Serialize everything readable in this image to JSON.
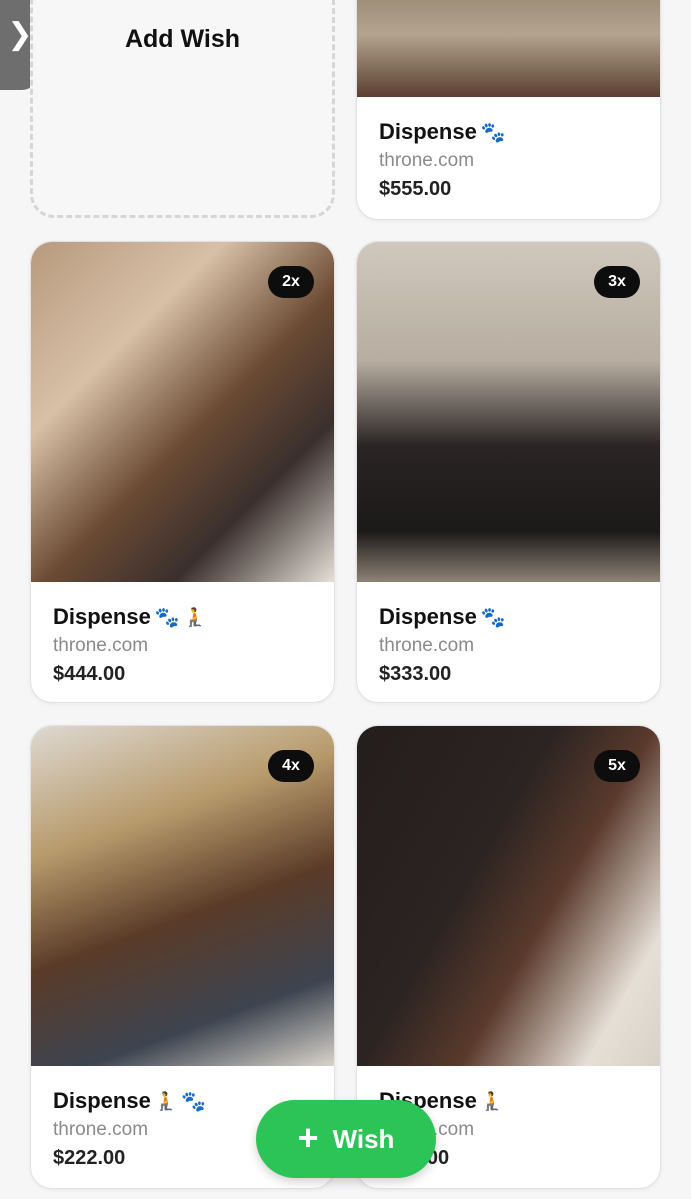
{
  "nav": {
    "side_tab_glyph": "❯"
  },
  "add_wish": {
    "label": "Add Wish"
  },
  "wishes": [
    {
      "title": "Dispense",
      "emojis": [
        "🐾"
      ],
      "site": "throne.com",
      "price": "$555.00",
      "badge": ""
    },
    {
      "title": "Dispense",
      "emojis": [
        "🐾",
        "🧎"
      ],
      "site": "throne.com",
      "price": "$444.00",
      "badge": "2x"
    },
    {
      "title": "Dispense",
      "emojis": [
        "🐾"
      ],
      "site": "throne.com",
      "price": "$333.00",
      "badge": "3x"
    },
    {
      "title": "Dispense",
      "emojis": [
        "🧎",
        "🐾"
      ],
      "site": "throne.com",
      "price": "$222.00",
      "badge": "4x"
    },
    {
      "title": "Dispense",
      "emojis": [
        "🧎"
      ],
      "site": "throne.com",
      "price": "$111.00",
      "badge": "5x"
    }
  ],
  "fab": {
    "plus": "+",
    "label": "Wish"
  },
  "colors": {
    "accent": "#2cc456",
    "background": "#f6f6f7",
    "badge": "#0d0d0d"
  }
}
